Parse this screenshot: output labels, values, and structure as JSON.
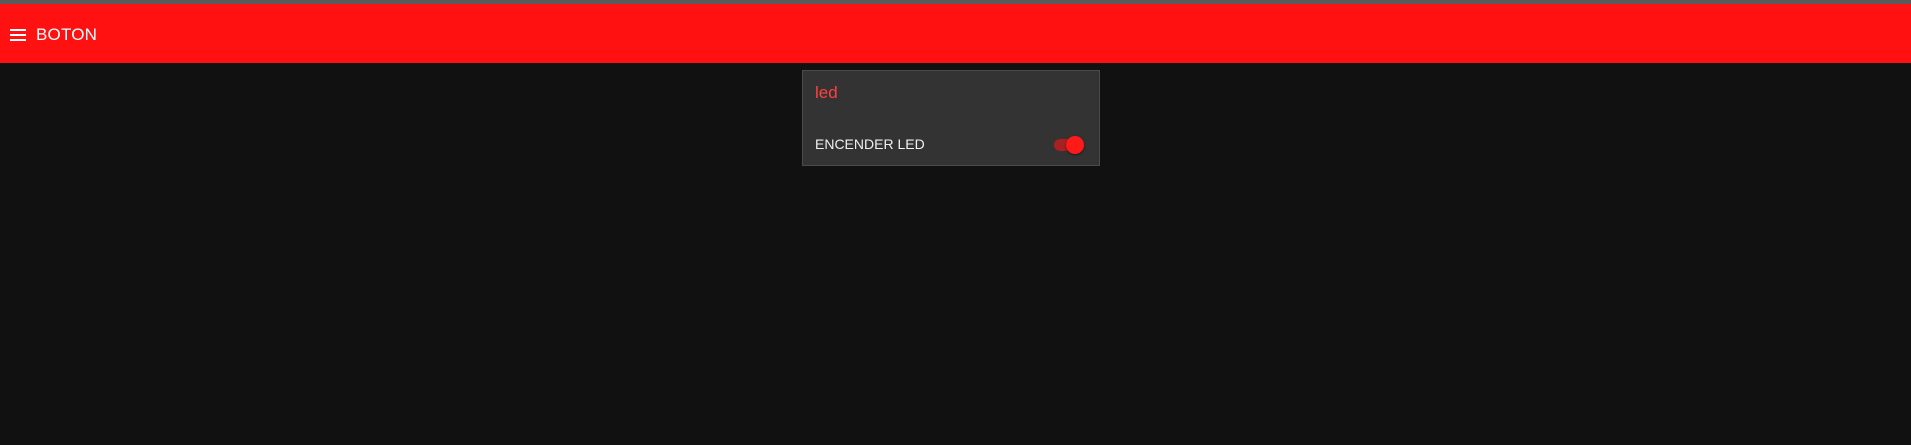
{
  "app": {
    "title": "BOTON",
    "header_color": "#ff1111"
  },
  "card": {
    "title": "led",
    "control": {
      "label": "ENCENDER LED",
      "state": "on"
    }
  },
  "icons": {
    "menu": "hamburger-menu-icon"
  }
}
